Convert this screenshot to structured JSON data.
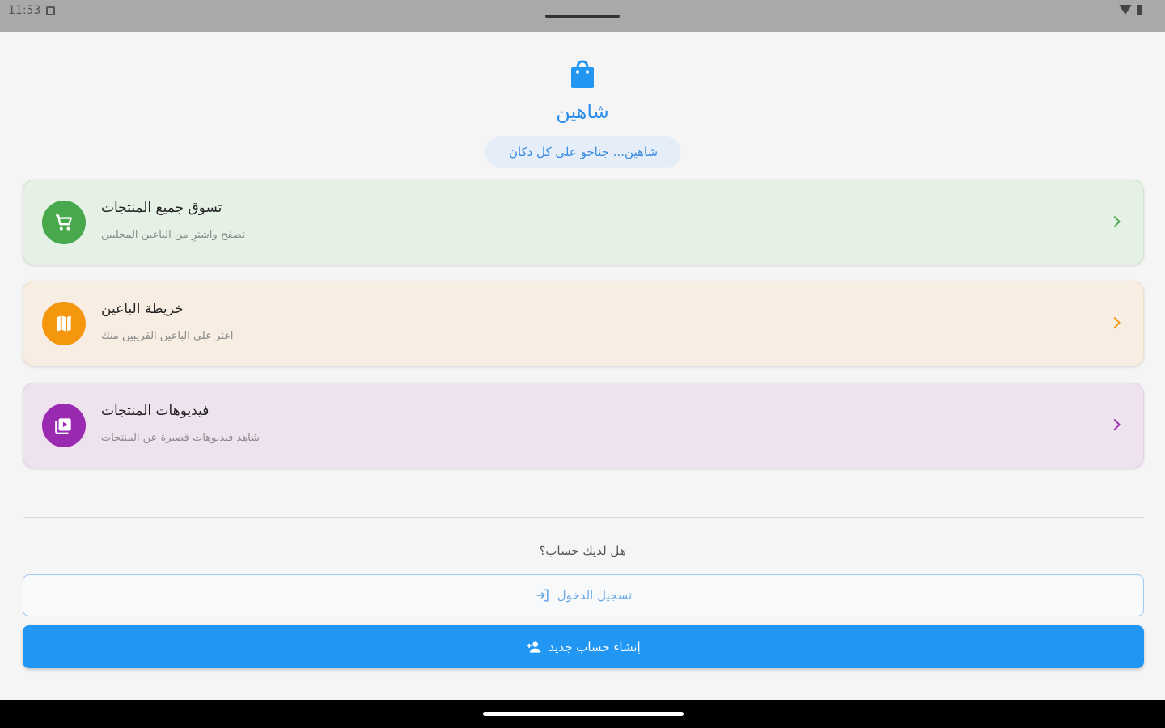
{
  "status_bar": {
    "time": "11:53",
    "icons": [
      "notification-icon",
      "wifi-icon",
      "battery-icon"
    ]
  },
  "header": {
    "logo_icon": "shopping-bag-icon",
    "app_name": "شاهين",
    "tagline": "شاهين... جناحو على كل دكان"
  },
  "cards": [
    {
      "title": "تسوق جميع المنتجات",
      "subtitle": "تصفح واشترِ من الباعين المحليين",
      "icon": "cart-icon",
      "color": "#47a84c",
      "background": "#e6f1e6"
    },
    {
      "title": "خريطة الباعين",
      "subtitle": "اعثر على الباعين القريبين منك",
      "icon": "map-icon",
      "color": "#f5960f",
      "background": "#f7ede2"
    },
    {
      "title": "فيديوهات المنتجات",
      "subtitle": "شاهد فيديوهات قصيرة عن المنتجات",
      "icon": "video-icon",
      "color": "#9a2ab0",
      "background": "#efe2ef"
    }
  ],
  "account": {
    "question": "هل لديك حساب؟",
    "login_label": "تسجيل الدخول",
    "signup_label": "إنشاء حساب جديد"
  },
  "colors": {
    "primary": "#2196f3",
    "title": "#2a8ee8"
  }
}
